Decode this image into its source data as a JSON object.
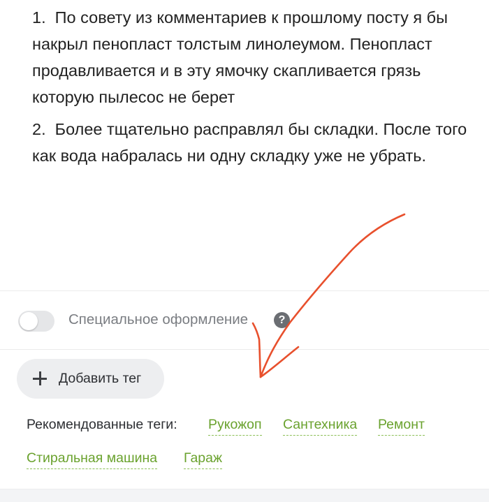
{
  "post": {
    "paragraphs": [
      "1.  По совету из комментариев к прошлому посту я бы накрыл пенопласт толстым линолеумом. Пенопласт продавливается и в эту ямочку скапливается грязь которую пылесос не берет",
      "2.  Более тщательно расправлял бы складки. После того как вода набралась ни одну складку уже не убрать."
    ]
  },
  "options": {
    "special_design_label": "Специальное оформление",
    "special_design_enabled": false,
    "help_glyph": "?"
  },
  "tags": {
    "add_tag_label": "Добавить тег",
    "recommended_label": "Рекомендованные теги:",
    "recommended": [
      "Рукожоп",
      "Сантехника",
      "Ремонт",
      "Стиральная машина",
      "Гараж"
    ]
  },
  "colors": {
    "tag_green": "#6aa22e",
    "annotation_arrow": "#e8502d",
    "toggle_off": "#e5e6e8"
  },
  "icons": {
    "plus": "plus-icon",
    "help": "question-circle-icon",
    "annotation": "hand-drawn-arrow"
  }
}
